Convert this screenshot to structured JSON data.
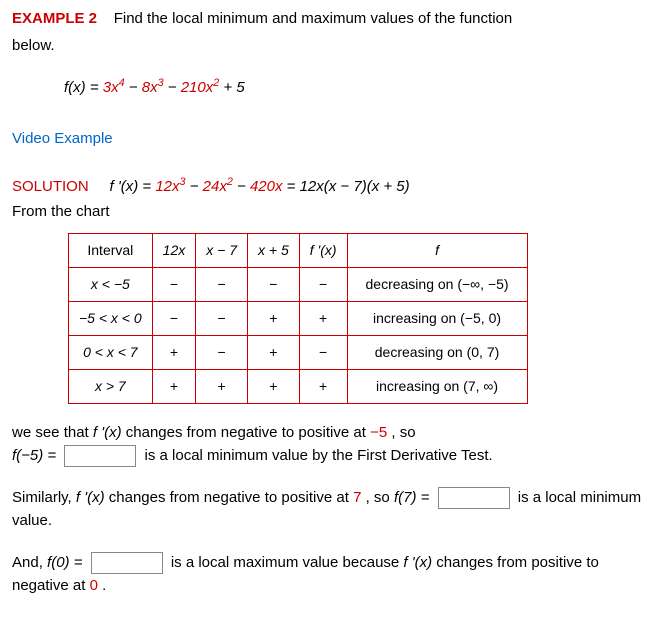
{
  "header": {
    "example_label": "EXAMPLE 2",
    "prompt_pre": "Find the local minimum and maximum values of the function",
    "prompt_post": "below."
  },
  "function_def": {
    "lhs": "f(x) = ",
    "t1": "3x",
    "e1": "4",
    "minus1": " − ",
    "t2": "8x",
    "e2": "3",
    "minus2": " − ",
    "t3": "210x",
    "e3": "2",
    "tail": " + 5"
  },
  "video_link": "Video Example",
  "solution": {
    "label": "SOLUTION",
    "d_lhs": "f '(x) = ",
    "d_t1": "12x",
    "d_e1": "3",
    "d_m1": " − ",
    "d_t2": "24x",
    "d_e2": "2",
    "d_m2": " − ",
    "d_t3": "420x",
    "d_eq": " = 12x(x − 7)(x + 5)",
    "chart_intro": "From the chart"
  },
  "table": {
    "headers": [
      "Interval",
      "12x",
      "x − 7",
      "x + 5",
      "f '(x)",
      "f"
    ],
    "rows": [
      {
        "interval": "x < −5",
        "c1": "−",
        "c2": "−",
        "c3": "−",
        "c4": "−",
        "desc": "decreasing on  (−∞, −5)"
      },
      {
        "interval": "−5 < x < 0",
        "c1": "−",
        "c2": "−",
        "c3": "+",
        "c4": "+",
        "desc": "increasing on  (−5, 0)"
      },
      {
        "interval": "0 < x < 7",
        "c1": "+",
        "c2": "−",
        "c3": "+",
        "c4": "−",
        "desc": "decreasing on  (0, 7)"
      },
      {
        "interval": "x > 7",
        "c1": "+",
        "c2": "+",
        "c3": "+",
        "c4": "+",
        "desc": "increasing on  (7, ∞)"
      }
    ]
  },
  "para1": {
    "a": "we see that  ",
    "b": "f '(x)",
    "c": "  changes from negative to positive at  ",
    "d": "−5",
    "e": ",  so",
    "f": "f(−5) = ",
    "g": " is a local minimum value by the First Derivative Test."
  },
  "para2": {
    "a": "Similarly,  ",
    "b": "f '(x)",
    "c": "  changes from negative to positive at ",
    "d": "7",
    "e": ", so  ",
    "f": "f(7) = ",
    "g": "  is a local minimum value."
  },
  "para3": {
    "a": "And,  ",
    "b": "f(0) = ",
    "c": "  is a local maximum value because  ",
    "d": "f '(x)",
    "e": "  changes from positive to negative at ",
    "f": "0",
    "g": "."
  }
}
